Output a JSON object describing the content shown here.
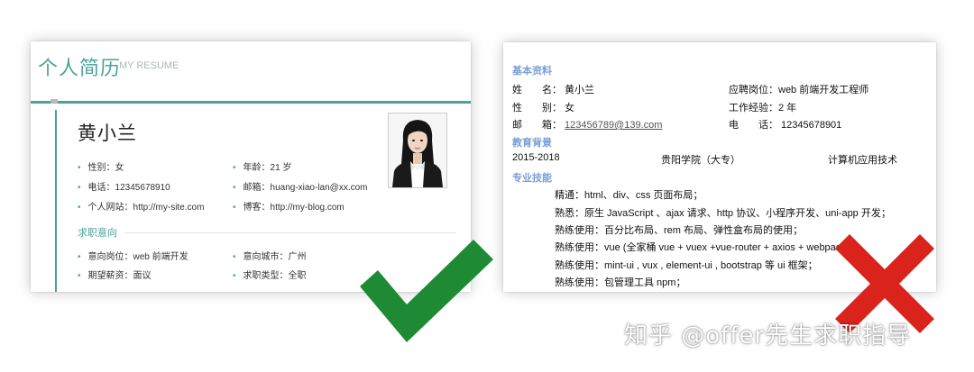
{
  "left_resume": {
    "title": "个人简历",
    "subtitle": "MY RESUME",
    "name": "黄小兰",
    "info": [
      {
        "text": "性别：女"
      },
      {
        "text": "年龄：21 岁"
      },
      {
        "text": "电话：12345678910"
      },
      {
        "text": "邮箱：huang-xiao-lan@xx.com"
      },
      {
        "text": "个人网站：http://my-site.com"
      },
      {
        "text": "博客：http://my-blog.com"
      }
    ],
    "section_title": "求职意向",
    "intent": [
      {
        "text": "意向岗位：web 前端开发"
      },
      {
        "text": "意向城市：广州"
      },
      {
        "text": "期望薪资：面议"
      },
      {
        "text": "求职类型：全职"
      }
    ],
    "accent_color": "#4aa39a"
  },
  "right_resume": {
    "basic_heading": "基本资料",
    "basic": {
      "name_label": "姓　　名：",
      "name_value": "黄小兰",
      "gender_label": "性　　别：",
      "gender_value": "女",
      "email_label": "邮　　箱：",
      "email_value": "123456789@139.com",
      "position_label": "应聘岗位：",
      "position_value": "web 前端开发工程师",
      "experience_label": "工作经验：",
      "experience_value": "2 年",
      "phone_label": "电　　话：",
      "phone_value": "12345678901"
    },
    "edu_heading": "教育背景",
    "edu": {
      "years": "2015-2018",
      "school": "贵阳学院（大专）",
      "major": "计算机应用技术"
    },
    "skills_heading": "专业技能",
    "skills": [
      "精通：html、div、css 页面布局；",
      "熟悉：原生 JavaScript 、ajax 请求、http 协议、小程序开发、uni-app 开发；",
      "熟练使用：百分比布局、rem 布局、弹性盒布局的使用；",
      "熟练使用：vue (全家桶 vue + vuex +vue-router + axios + webpack )；",
      "熟练使用：mint-ui , vux , element-ui ,  bootstrap 等 ui 框架；",
      "熟练使用：包管理工具 npm；"
    ],
    "heading_color": "#7b9ed6"
  },
  "overlays": {
    "check_icon": "check-icon",
    "check_color": "#1e8a33",
    "cross_icon": "cross-icon",
    "cross_color": "#d9231b",
    "watermark": "知乎 @offer先生求职指导"
  }
}
